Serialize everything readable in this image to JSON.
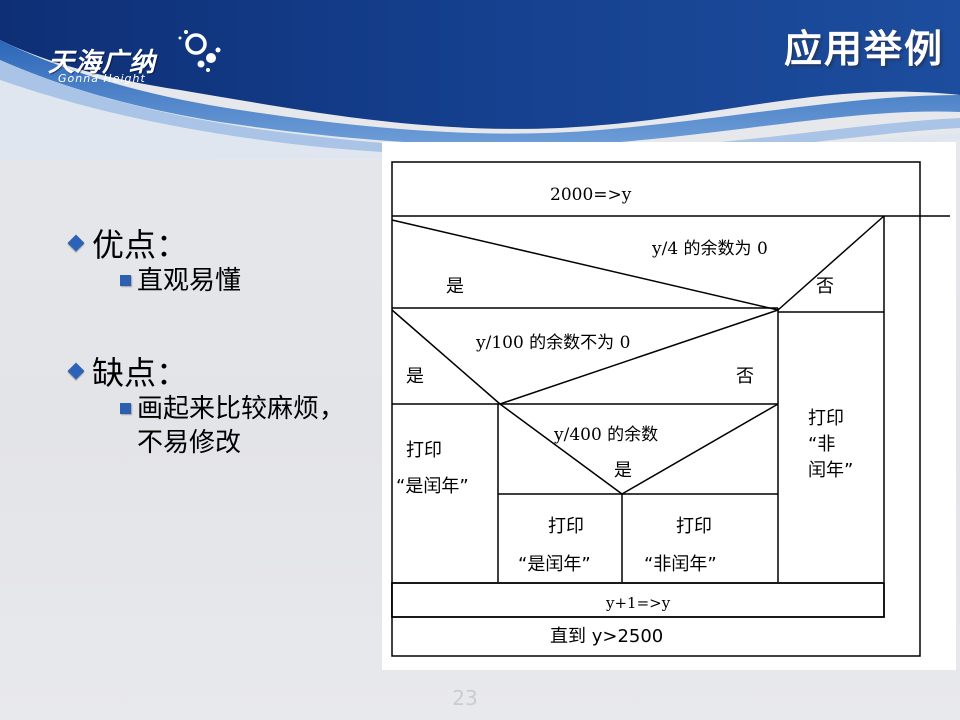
{
  "brand": {
    "name": "天海广纳",
    "tagline": "Gonna Height"
  },
  "title": "应用举例",
  "advantages": {
    "heading": "优点：",
    "items": [
      "直观易懂"
    ]
  },
  "disadvantages": {
    "heading": "缺点：",
    "items": [
      "画起来比较麻烦，",
      "不易修改"
    ]
  },
  "flowchart": {
    "init": "2000=>y",
    "cond1": "y/4 的余数为 0",
    "cond1_yes": "是",
    "cond1_no": "否",
    "cond2": "y/100 的余数不为 0",
    "cond2_yes": "是",
    "cond2_no": "否",
    "cond3": "y/400 的余数",
    "cond3_yes": "是",
    "print_label": "打印",
    "leap_year": "“是闰年”",
    "non_leap_year": "“非闰年”",
    "right_print": "打印",
    "right_quote_fei": "“非",
    "right_run_nian": "闰年”",
    "increment": "y+1=>y",
    "until": "直到 y>2500"
  },
  "page_number": "23",
  "colors": {
    "header_dark": "#0b2a6e",
    "header_mid": "#2a5db0",
    "bullet": "#2c63b8"
  }
}
